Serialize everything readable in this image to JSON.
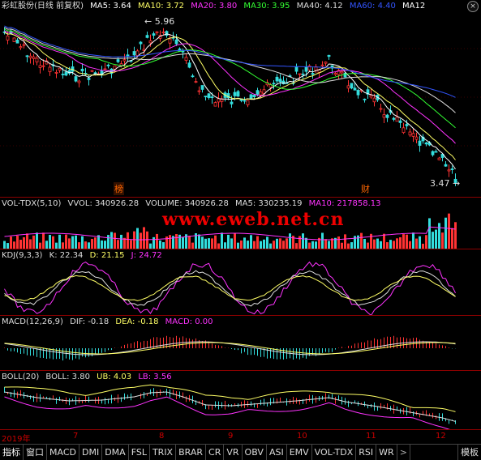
{
  "window": {
    "close_glyph": "×"
  },
  "main_panel": {
    "stock_name": "彩虹股份(日线 前复权)",
    "ma": [
      {
        "label": "MA5: 3.64",
        "color": "#ffffff"
      },
      {
        "label": "MA10: 3.72",
        "color": "#ffff66"
      },
      {
        "label": "MA20: 3.80",
        "color": "#ff33ff"
      },
      {
        "label": "MA30: 3.95",
        "color": "#33ff33"
      },
      {
        "label": "MA40: 4.12",
        "color": "#dddddd"
      },
      {
        "label": "MA60: 4.40",
        "color": "#3355ff"
      },
      {
        "label": "MA12",
        "color": "#ffffff"
      }
    ],
    "high_label": "5.96",
    "low_label": "3.47",
    "marker_bang": "榜",
    "marker_cai": "财"
  },
  "vol_panel": {
    "items": [
      {
        "label": "VOL-TDX(5,10)",
        "color": "#dddddd"
      },
      {
        "label": "VVOL: 340926.28",
        "color": "#dddddd"
      },
      {
        "label": "VOLUME: 340926.28",
        "color": "#dddddd"
      },
      {
        "label": "MA5: 330235.19",
        "color": "#dddddd"
      },
      {
        "label": "MA10: 217858.13",
        "color": "#ff33ff"
      }
    ],
    "watermark": "www.eweb.net.cn"
  },
  "kdj_panel": {
    "items": [
      {
        "label": "KDJ(9,3,3)",
        "color": "#dddddd"
      },
      {
        "label": "K: 22.34",
        "color": "#dddddd"
      },
      {
        "label": "D: 21.15",
        "color": "#ffff66"
      },
      {
        "label": "J: 24.72",
        "color": "#ff33ff"
      }
    ]
  },
  "macd_panel": {
    "items": [
      {
        "label": "MACD(12,26,9)",
        "color": "#dddddd"
      },
      {
        "label": "DIF: -0.18",
        "color": "#dddddd"
      },
      {
        "label": "DEA: -0.18",
        "color": "#ffff66"
      },
      {
        "label": "MACD: 0.00",
        "color": "#ff33ff"
      }
    ]
  },
  "boll_panel": {
    "items": [
      {
        "label": "BOLL(20)",
        "color": "#dddddd"
      },
      {
        "label": "BOLL: 3.80",
        "color": "#dddddd"
      },
      {
        "label": "UB: 4.03",
        "color": "#ffff66"
      },
      {
        "label": "LB: 3.56",
        "color": "#ff33ff"
      }
    ]
  },
  "time_axis": {
    "labels": [
      "2019年",
      "7",
      "8",
      "9",
      "10",
      "11",
      "12"
    ]
  },
  "tabs": [
    "指标",
    "窗口",
    "MACD",
    "DMI",
    "DMA",
    "FSL",
    "TRIX",
    "BRAR",
    "CR",
    "VR",
    "OBV",
    "ASI",
    "EMV",
    "VOL-TDX",
    "RSI",
    "WR"
  ],
  "tab_arrow": ">",
  "tab_right": "模板"
}
